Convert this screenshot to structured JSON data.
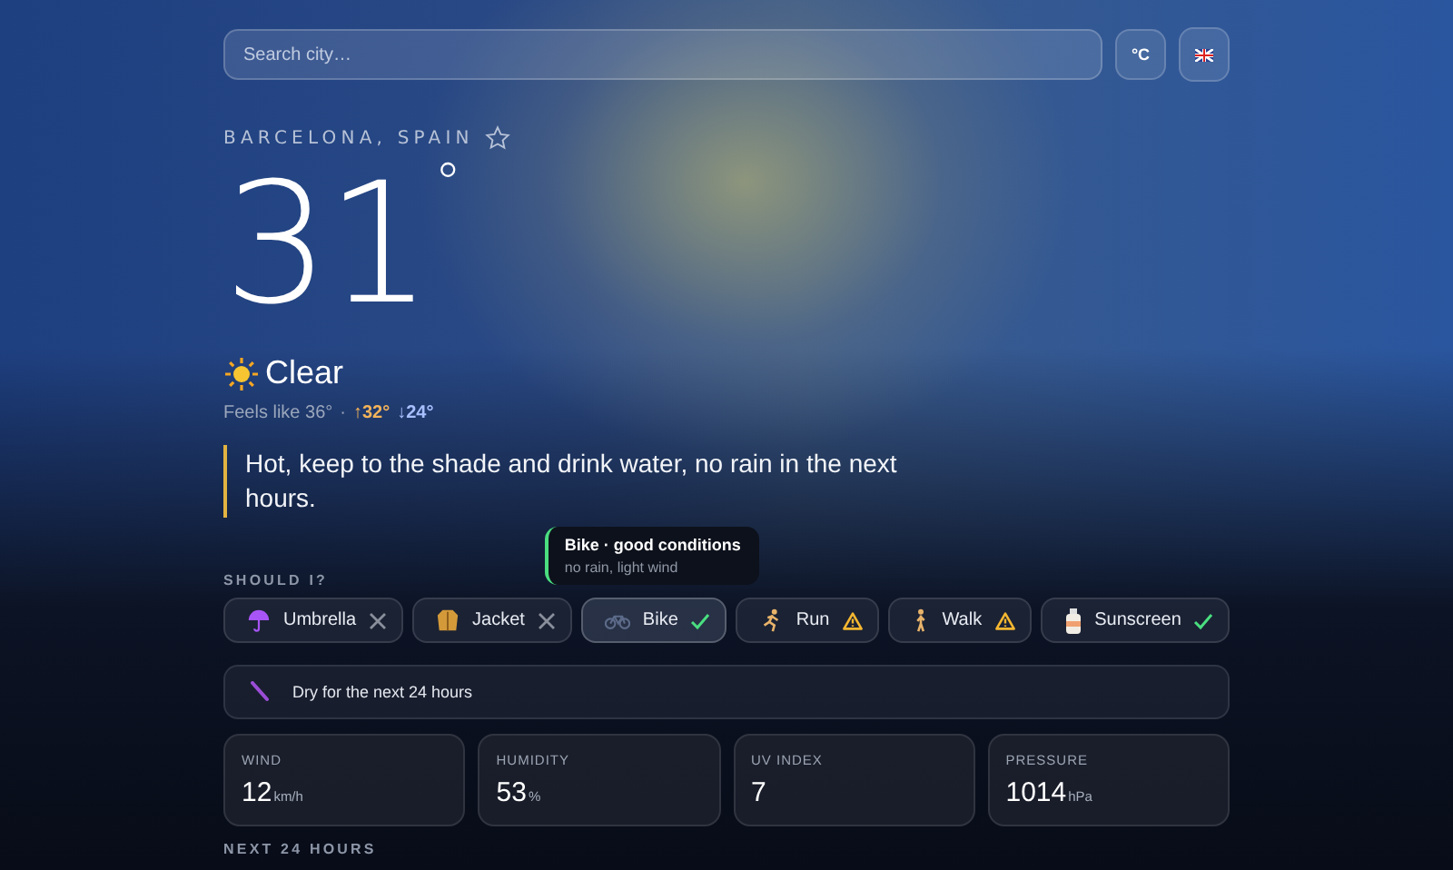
{
  "search": {
    "placeholder": "Search city…"
  },
  "unit_button": "°C",
  "location": {
    "name": "BARCELONA, SPAIN",
    "favorite": false
  },
  "current": {
    "temperature": "31",
    "degree": "°",
    "condition": "Clear",
    "feels_like": "Feels like 36°",
    "separator": "·",
    "high": "↑32°",
    "low": "↓24°"
  },
  "advice": "Hot, keep to the shade and drink water, no rain in the next hours.",
  "should_i": {
    "heading": "SHOULD I?",
    "tooltip": {
      "title": "Bike · good conditions",
      "detail": "no rain, light wind"
    },
    "items": [
      {
        "label": "Umbrella",
        "kind": "umbrella",
        "recommended": false,
        "caution": false,
        "selected": false
      },
      {
        "label": "Jacket",
        "kind": "jacket",
        "recommended": false,
        "caution": false,
        "selected": false
      },
      {
        "label": "Bike",
        "kind": "bike",
        "recommended": true,
        "caution": false,
        "selected": true
      },
      {
        "label": "Run",
        "kind": "run",
        "recommended": false,
        "caution": true,
        "selected": false
      },
      {
        "label": "Walk",
        "kind": "walk",
        "recommended": false,
        "caution": true,
        "selected": false
      },
      {
        "label": "Sunscreen",
        "kind": "sunscreen",
        "recommended": true,
        "caution": false,
        "selected": false
      }
    ]
  },
  "rain_outlook": "Dry for the next 24 hours",
  "stats": [
    {
      "label": "WIND",
      "value": "12",
      "unit": "km/h"
    },
    {
      "label": "HUMIDITY",
      "value": "53",
      "unit": "%"
    },
    {
      "label": "UV INDEX",
      "value": "7"
    },
    {
      "label": "PRESSURE",
      "value": "1014",
      "unit": "hPa"
    }
  ],
  "next_heading": "NEXT 24 HOURS"
}
